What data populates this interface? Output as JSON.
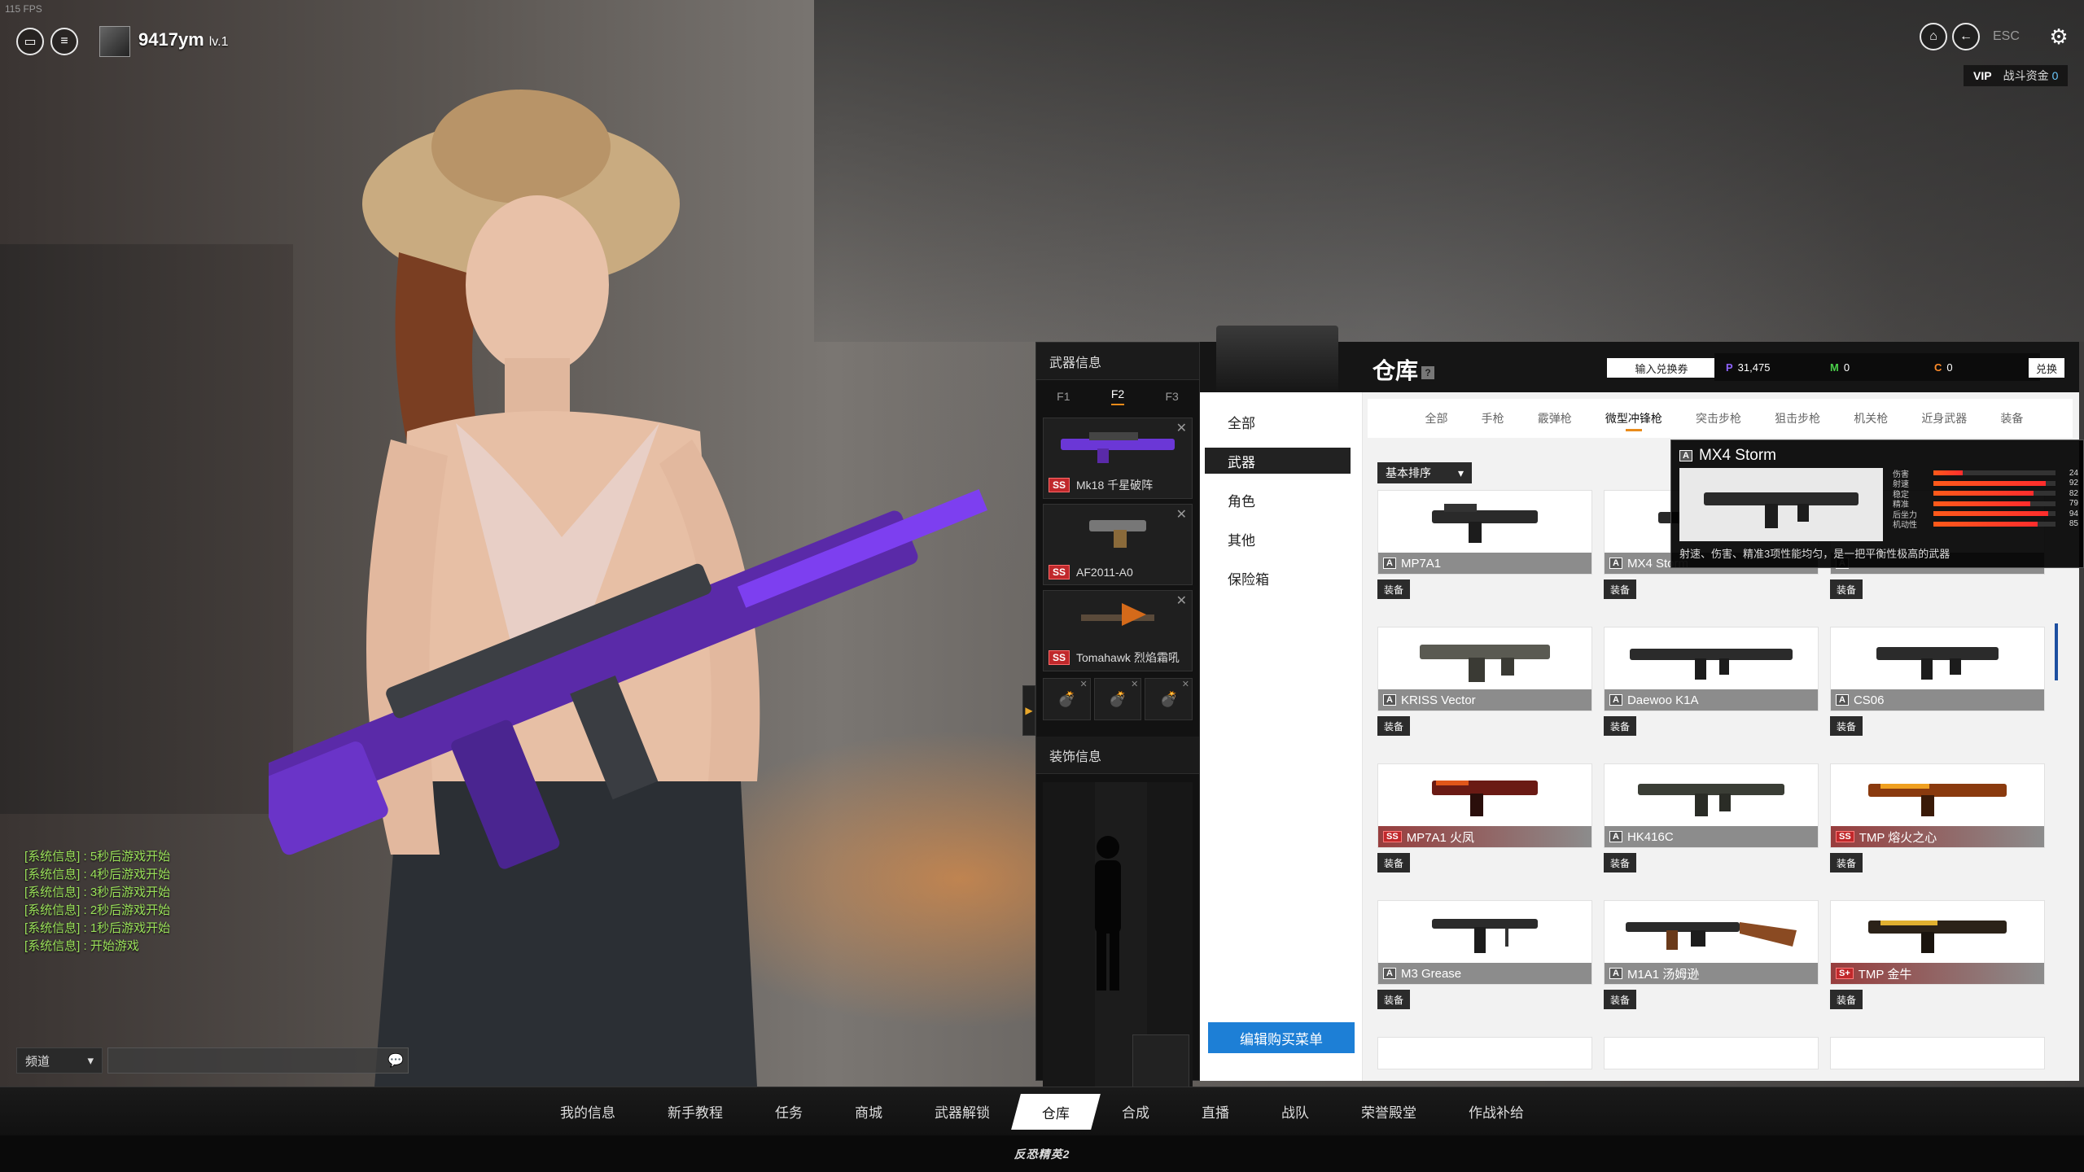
{
  "hud": {
    "fps": "115 FPS",
    "player_name": "9417ym",
    "player_level": "lv.1",
    "esc": "ESC",
    "vip": "VIP",
    "funds_label": "战斗资金",
    "funds_value": "0"
  },
  "chat": {
    "lines": [
      "[系统信息] : 5秒后游戏开始",
      "[系统信息] : 4秒后游戏开始",
      "[系统信息] : 3秒后游戏开始",
      "[系统信息] : 2秒后游戏开始",
      "[系统信息] : 1秒后游戏开始",
      "[系统信息] : 开始游戏"
    ],
    "channel": "频道"
  },
  "loadout": {
    "title": "武器信息",
    "tabs": [
      "F1",
      "F2",
      "F3"
    ],
    "slots": [
      {
        "grade": "SS",
        "name": "Mk18 千星破阵"
      },
      {
        "grade": "SS",
        "name": "AF2011-A0"
      },
      {
        "grade": "SS",
        "name": "Tomahawk 烈焰霜吼"
      }
    ],
    "costume_title": "装饰信息"
  },
  "warehouse": {
    "title": "仓库",
    "help": "?",
    "redeem_btn": "输入兑换券",
    "currencies": [
      {
        "symbol": "P",
        "value": "31,475"
      },
      {
        "symbol": "M",
        "value": "0"
      },
      {
        "symbol": "C",
        "value": "0"
      }
    ],
    "exchange_btn": "兑换",
    "sidebar": [
      "全部",
      "武器",
      "角色",
      "其他",
      "保险箱"
    ],
    "sidebar_active": 1,
    "edit_buy_btn": "编辑购买菜单",
    "categories": [
      "全部",
      "手枪",
      "霰弹枪",
      "微型冲锋枪",
      "突击步枪",
      "狙击步枪",
      "机关枪",
      "近身武器",
      "装备"
    ],
    "category_active": 3,
    "sort": "基本排序",
    "equip_label": "装备",
    "items": [
      {
        "name": "MP7A1",
        "grade": "A",
        "ss": false
      },
      {
        "name": "MX4 Storm",
        "grade": "A",
        "ss": false
      },
      {
        "name": "",
        "grade": "A",
        "ss": false
      },
      {
        "name": "KRISS Vector",
        "grade": "A",
        "ss": false
      },
      {
        "name": "Daewoo K1A",
        "grade": "A",
        "ss": false
      },
      {
        "name": "CS06",
        "grade": "A",
        "ss": false
      },
      {
        "name": "MP7A1 火凤",
        "grade": "SS",
        "ss": true
      },
      {
        "name": "HK416C",
        "grade": "A",
        "ss": false
      },
      {
        "name": "TMP 熔火之心",
        "grade": "SS",
        "ss": true
      },
      {
        "name": "M3 Grease",
        "grade": "A",
        "ss": false
      },
      {
        "name": "M1A1 汤姆逊",
        "grade": "A",
        "ss": false
      },
      {
        "name": "TMP 金牛",
        "grade": "S+",
        "ss": true
      }
    ]
  },
  "tooltip": {
    "name": "MX4 Storm",
    "grade": "A",
    "stats": [
      {
        "label": "伤害",
        "value": 24
      },
      {
        "label": "射速",
        "value": 92
      },
      {
        "label": "稳定",
        "value": 82
      },
      {
        "label": "精准",
        "value": 79
      },
      {
        "label": "后坐力",
        "value": 94
      },
      {
        "label": "机动性",
        "value": 85
      }
    ],
    "description": "射速、伤害、精准3项性能均匀，是一把平衡性极高的武器"
  },
  "nav": {
    "items": [
      "我的信息",
      "新手教程",
      "任务",
      "商城",
      "武器解锁",
      "仓库",
      "合成",
      "直播",
      "战队",
      "荣誉殿堂",
      "作战补给"
    ],
    "active": 5
  },
  "logo": "反恐精英2",
  "colors": {
    "accent_orange": "#e98b1a",
    "button_blue": "#1d7fd6",
    "ss_red": "#c0282b",
    "chat_green": "#9be25a"
  }
}
